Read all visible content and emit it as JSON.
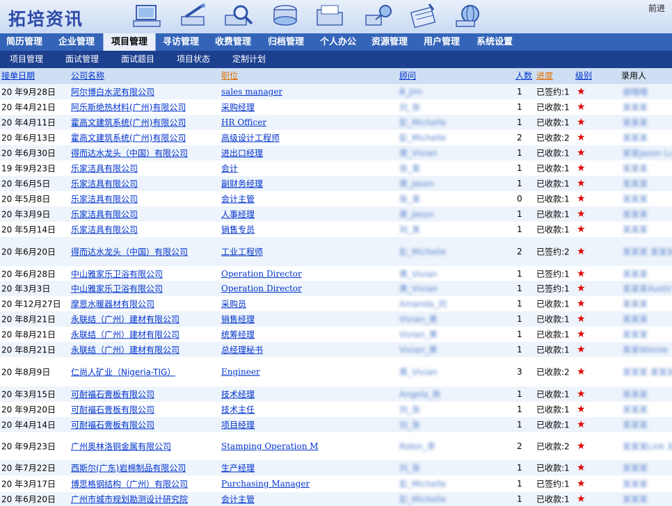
{
  "app": {
    "title": "拓培资讯",
    "forward": "前进"
  },
  "nav_main": [
    "简历管理",
    "企业管理",
    "项目管理",
    "寻访管理",
    "收费管理",
    "归档管理",
    "个人办公",
    "资源管理",
    "用户管理",
    "系统设置"
  ],
  "nav_sub": [
    "项目管理",
    "面试管理",
    "面试题目",
    "项目状态",
    "定制计划"
  ],
  "table": {
    "headers": [
      "接单日期",
      "公司名称",
      "职位",
      "顾问",
      "人数",
      "进度",
      "级别",
      "录用人"
    ],
    "rows": [
      {
        "date": "20  年9月28日",
        "company": "阿尔博白水泥有限公司",
        "position": "sales manager",
        "consultant": "Ⅲ_Jim",
        "count": "1",
        "status": "已签约:1",
        "hire": "谢哦哦"
      },
      {
        "date": "20  年4月21日",
        "company": "阿乐斯绝热材料(广州)有限公司",
        "position": "采购经理",
        "consultant": "刘_张",
        "count": "1",
        "status": "已收款:1",
        "hire": "某某某"
      },
      {
        "date": "20  年4月11日",
        "company": "霍高文建筑系统(广州)有限公司",
        "position": "HR Officer",
        "consultant": "彭_Michelle",
        "count": "1",
        "status": "已收款:1",
        "hire": "某某某"
      },
      {
        "date": "20  年6月13日",
        "company": "霍高文建筑系统(广州)有限公司",
        "position": "高级设计工程师",
        "consultant": "彭_Michelle",
        "count": "2",
        "status": "已收款:2",
        "hire": "某某某"
      },
      {
        "date": "20  年6月30日",
        "company": "得而达水龙头（中国）有限公司",
        "position": "进出口经理",
        "consultant": "黄_Vivian",
        "count": "1",
        "status": "已收款:1",
        "hire": "某某Jason Lan"
      },
      {
        "date": "19  年9月23日",
        "company": "乐家洁具有限公司",
        "position": "会计",
        "consultant": "张_某",
        "count": "1",
        "status": "已收款:1",
        "hire": "某某某"
      },
      {
        "date": "20  年6月5日",
        "company": "乐家洁具有限公司",
        "position": "副财务经理",
        "consultant": "黄_Jason",
        "count": "1",
        "status": "已收款:1",
        "hire": "某某某"
      },
      {
        "date": "20  年5月8日",
        "company": "乐家洁具有限公司",
        "position": "会计主管",
        "consultant": "张_某",
        "count": "0",
        "status": "已收款:1",
        "hire": "某某某"
      },
      {
        "date": "20  年3月9日",
        "company": "乐家洁具有限公司",
        "position": "人事经理",
        "consultant": "黄_Jason",
        "count": "1",
        "status": "已收款:1",
        "hire": "某某某"
      },
      {
        "date": "20  年5月14日",
        "company": "乐家洁具有限公司",
        "position": "销售专员",
        "consultant": "刘_某",
        "count": "1",
        "status": "已收款:1",
        "hire": "某某某"
      },
      {
        "date": "20  年6月20日",
        "company": "得而达水龙头（中国）有限公司",
        "position": "工业工程师",
        "consultant": "彭_Michelle",
        "count": "2",
        "status": "已签约:2",
        "hire": "某某某 某某某"
      },
      {
        "date": "20  年6月28日",
        "company": "中山雅家乐卫浴有限公司",
        "position": "Operation Director",
        "consultant": "黄_Vivian",
        "count": "1",
        "status": "已签约:1",
        "hire": "某某某"
      },
      {
        "date": "20  年3月3日",
        "company": "中山雅家乐卫浴有限公司",
        "position": "Operation Director",
        "consultant": "黄_Vivian",
        "count": "1",
        "status": "已签约:1",
        "hire": "某某某Austin"
      },
      {
        "date": "20  年12月27日",
        "company": "摩恩水暖器材有限公司",
        "position": "采购员",
        "consultant": "Amanda_刘",
        "count": "1",
        "status": "已收款:1",
        "hire": "某某某"
      },
      {
        "date": "20  年8月21日",
        "company": "永联结（广州）建材有限公司",
        "position": "销售经理",
        "consultant": "Vivian_黄",
        "count": "1",
        "status": "已收款:1",
        "hire": "某某某"
      },
      {
        "date": "20  年8月21日",
        "company": "永联结（广州）建材有限公司",
        "position": "统筹经理",
        "consultant": "Vivian_黄",
        "count": "1",
        "status": "已收款:1",
        "hire": "某某某"
      },
      {
        "date": "20  年8月21日",
        "company": "永联结（广州）建材有限公司",
        "position": "总经理秘书",
        "consultant": "Vivian_黄",
        "count": "1",
        "status": "已收款:1",
        "hire": "某某Winnie"
      },
      {
        "date": "20  年8月9日",
        "company": "仁尚人矿业（Nigeria-TIG）",
        "position": "Engineer",
        "consultant": "黄_Vivian",
        "count": "3",
        "status": "已收款:2",
        "hire": "某某某 某某某 某某某"
      },
      {
        "date": "20  年3月15日",
        "company": "可耐福石膏板有限公司",
        "position": "技术经理",
        "consultant": "Angela_陈",
        "count": "1",
        "status": "已收款:1",
        "hire": "某某某"
      },
      {
        "date": "20  年9月20日",
        "company": "可耐福石膏板有限公司",
        "position": "技术主任",
        "consultant": "刘_张",
        "count": "1",
        "status": "已收款:1",
        "hire": "某某某"
      },
      {
        "date": "20  年4月14日",
        "company": "可耐福石膏板有限公司",
        "position": "项目经理",
        "consultant": "刘_张",
        "count": "1",
        "status": "已收款:1",
        "hire": "某某某"
      },
      {
        "date": "20  年9月23日",
        "company": "广州奥林洛铜金属有限公司",
        "position": "Stamping Operation M",
        "consultant": "Robin_李",
        "count": "2",
        "status": "已收款:2",
        "hire": "某某某Link 某某某"
      },
      {
        "date": "20  年7月22日",
        "company": "西斯尔(广东)岩棉制品有限公司",
        "position": "生产经理",
        "consultant": "刘_张",
        "count": "1",
        "status": "已收款:1",
        "hire": "某某某"
      },
      {
        "date": "20  年3月17日",
        "company": "博思格钢结构（广州）有限公司",
        "position": "Purchasing Manager",
        "consultant": "彭_Michelle",
        "count": "1",
        "status": "已签约:1",
        "hire": "某某某"
      },
      {
        "date": "20  年6月20日",
        "company": "广州市城市规划勘测设计研究院",
        "position": "会计主管",
        "consultant": "彭_Michelle",
        "count": "1",
        "status": "已收款:1",
        "hire": "某某某"
      }
    ]
  },
  "colors": {
    "nav_main_bg": "#3464b8",
    "nav_sub_bg": "#1c3f8e",
    "header_bg": "#cfdff3",
    "link": "#0033cc",
    "star": "#e00000",
    "progress_header": "#e07000"
  },
  "icons": [
    "computer-icon",
    "tools-icon",
    "magnifier-icon",
    "database-icon",
    "folder-icon",
    "network-icon",
    "calculator-icon",
    "globe-icon"
  ]
}
